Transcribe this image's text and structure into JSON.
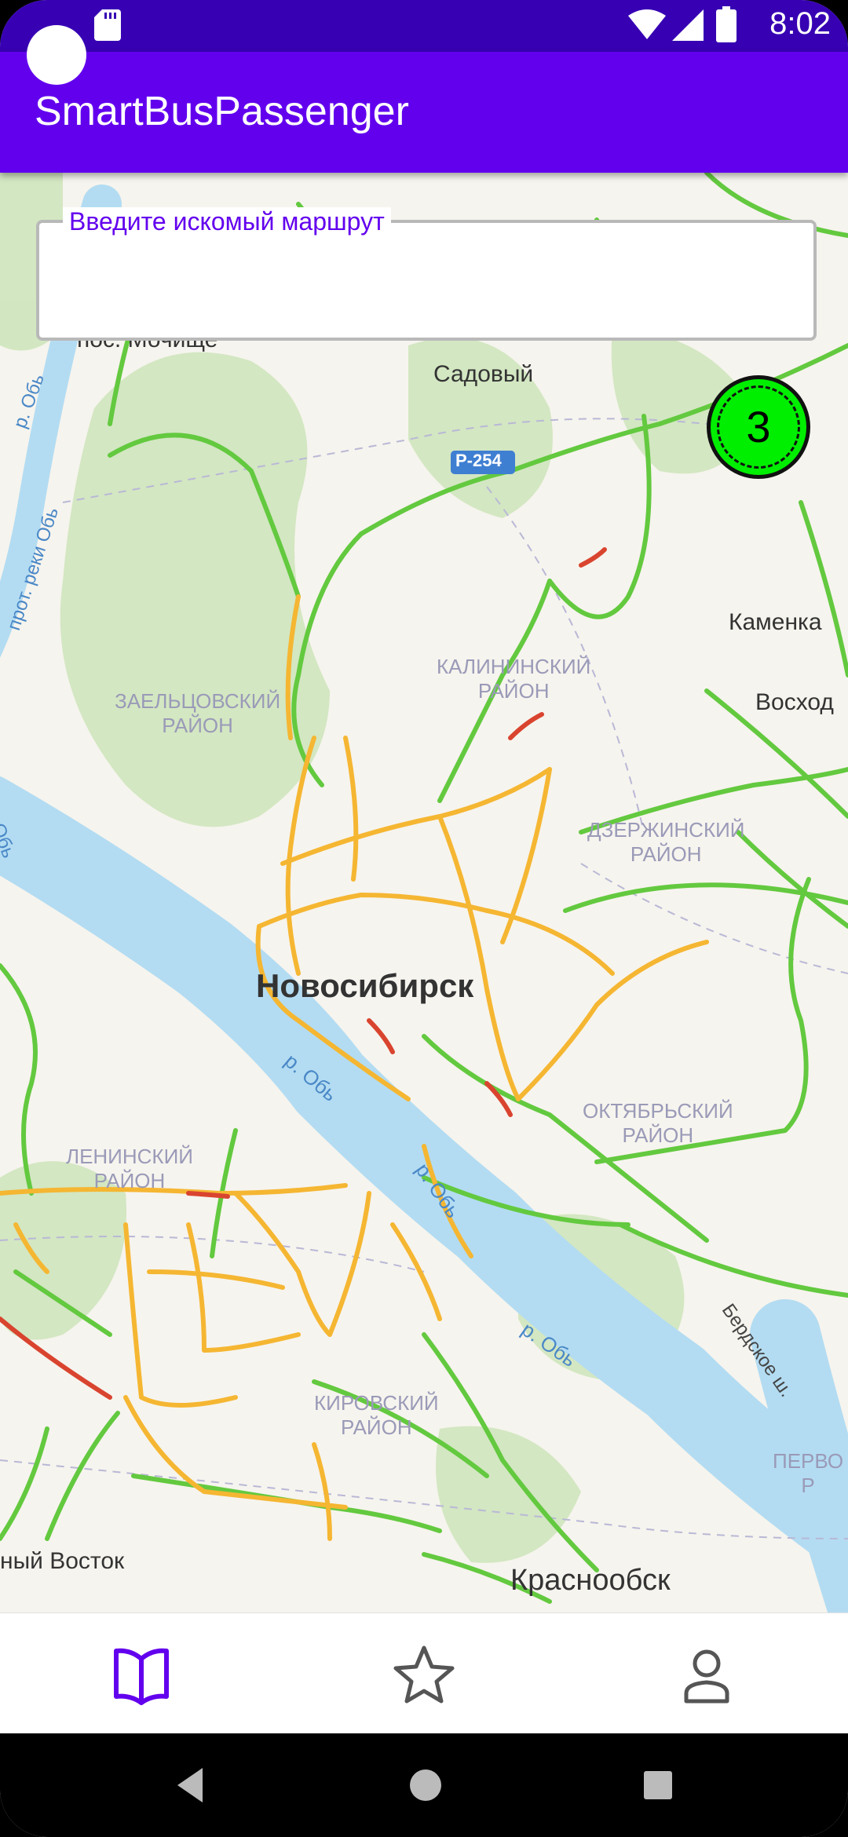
{
  "status_bar": {
    "time": "8:02"
  },
  "app_bar": {
    "title": "SmartBusPassenger"
  },
  "search": {
    "label": "Введите искомый маршрут",
    "value": ""
  },
  "map": {
    "cluster_count": "3",
    "road_badge": "Р-254",
    "labels": {
      "city": "Новосибирск",
      "mochishche": "пос. Мочище",
      "sadovy": "Садовый",
      "kamenka": "Каменка",
      "voskhod": "Восход",
      "kalininsky": [
        "КАЛИНИНСКИЙ",
        "РАЙОН"
      ],
      "zaeltsovsky": [
        "ЗАЕЛЬЦОВСКИЙ",
        "РАЙОН"
      ],
      "dzerzhinsky": [
        "ДЗЕРЖИНСКИЙ",
        "РАЙОН"
      ],
      "oktyabrsky": [
        "ОКТЯБРЬСКИЙ",
        "РАЙОН"
      ],
      "leninsky": [
        "ЛЕНИНСКИЙ",
        "РАЙОН"
      ],
      "kirovsky": [
        "КИРОВСКИЙ",
        "РАЙОН"
      ],
      "pervo": [
        "ПЕРВО",
        "Р"
      ],
      "ob_1": "р. Обь",
      "ob_2": "р. Обь",
      "ob_3": "р. Обь",
      "ob_4": "р. Обь",
      "ob_5": "р. Обь",
      "ob_channel": "прот. реки Обь",
      "berdskoe": "Бердское ш.",
      "krasnoobsk": "Краснообск",
      "vostok": "ный Восток"
    }
  },
  "bottom_nav": {
    "items": [
      {
        "name": "routes",
        "icon": "book-icon",
        "active": true
      },
      {
        "name": "favorites",
        "icon": "star-icon",
        "active": false
      },
      {
        "name": "profile",
        "icon": "person-icon",
        "active": false
      }
    ],
    "active_color": "#6200ee",
    "inactive_color": "#555555"
  },
  "colors": {
    "status_bar": "#3700b3",
    "app_bar": "#6200ee",
    "cluster": "#00ee00"
  }
}
